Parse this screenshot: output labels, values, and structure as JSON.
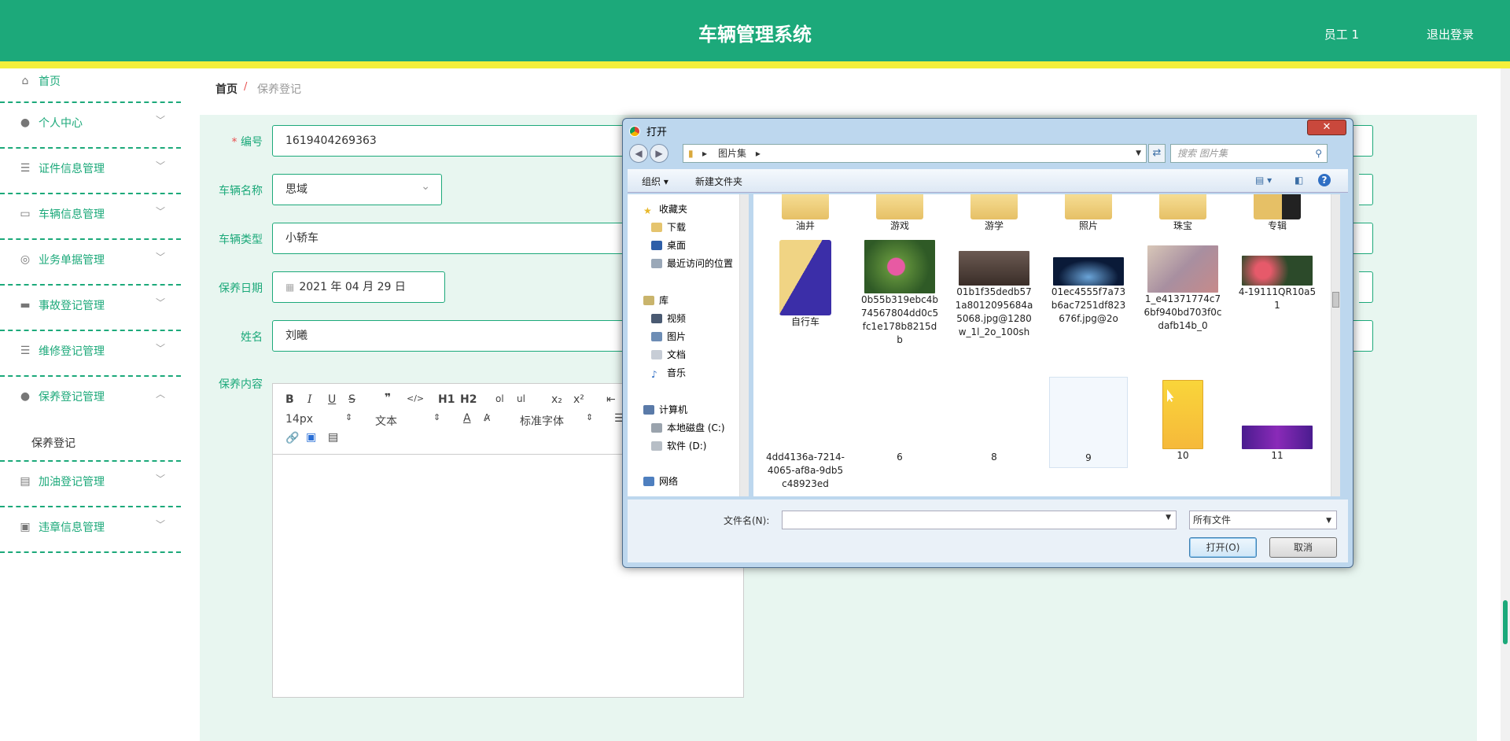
{
  "header": {
    "title": "车辆管理系统",
    "user": "员工 1",
    "logout": "退出登录"
  },
  "sidebar": {
    "items": [
      {
        "label": "首页",
        "icon": "home-icon"
      },
      {
        "label": "个人中心",
        "icon": "user-icon"
      },
      {
        "label": "证件信息管理",
        "icon": "list-icon"
      },
      {
        "label": "车辆信息管理",
        "icon": "chat-icon"
      },
      {
        "label": "业务单据管理",
        "icon": "compass-icon"
      },
      {
        "label": "事故登记管理",
        "icon": "message-icon"
      },
      {
        "label": "维修登记管理",
        "icon": "list-icon"
      },
      {
        "label": "保养登记管理",
        "icon": "user-icon"
      },
      {
        "label": "加油登记管理",
        "icon": "chart-icon"
      },
      {
        "label": "违章信息管理",
        "icon": "clipboard-icon"
      }
    ],
    "sub_item": "保养登记"
  },
  "breadcrumb": {
    "home": "首页",
    "sep": "/",
    "current": "保养登记"
  },
  "form": {
    "number_label": "编号",
    "number_star": "*",
    "number_value": "1619404269363",
    "car_name_label": "车辆名称",
    "car_name_value": "思域",
    "car_type_label": "车辆类型",
    "car_type_value": "小轿车",
    "date_label": "保养日期",
    "date_value": "2021 年 04 月 29 日",
    "name_label": "姓名",
    "name_value": "刘曦",
    "content_label": "保养内容"
  },
  "editor": {
    "font_size": "14px",
    "text_style": "文本",
    "font_family": "标准字体",
    "buttons": [
      "B",
      "I",
      "U",
      "S",
      "❞",
      "</>",
      "H1",
      "H2",
      "ol",
      "ul",
      "x₂",
      "x²"
    ]
  },
  "dialog": {
    "title": "打开",
    "path": "图片集",
    "search_placeholder": "搜索 图片集",
    "organize": "组织 ▾",
    "new_folder": "新建文件夹",
    "nav": {
      "favorites": "收藏夹",
      "downloads": "下载",
      "desktop": "桌面",
      "recent": "最近访问的位置",
      "library": "库",
      "videos": "视频",
      "pictures": "图片",
      "docs": "文档",
      "music": "音乐",
      "computer": "计算机",
      "disk_c": "本地磁盘 (C:)",
      "disk_d": "软件 (D:)",
      "network": "网络"
    },
    "folders_row1": [
      "油井",
      "游戏",
      "游学",
      "照片",
      "珠宝",
      "专辑"
    ],
    "files_row2": [
      "自行车",
      "0b55b319ebc4b74567804dd0c5fc1e178b8215db",
      "01b1f35dedb571a8012095684a5068.jpg@1280w_1l_2o_100sh",
      "01ec4555f7a73b6ac7251df823676f.jpg@2o",
      "1_e41371774c76bf940bd703f0cdafb14b_0",
      "4-19111QR10a51"
    ],
    "files_row3": [
      "4dd4136a-7214-4065-af8a-9db5c48923ed",
      "6",
      "8",
      "9",
      "10",
      "11"
    ],
    "filename_label": "文件名(N):",
    "filename_value": "",
    "filter": "所有文件",
    "open": "打开(O)",
    "cancel": "取消"
  }
}
